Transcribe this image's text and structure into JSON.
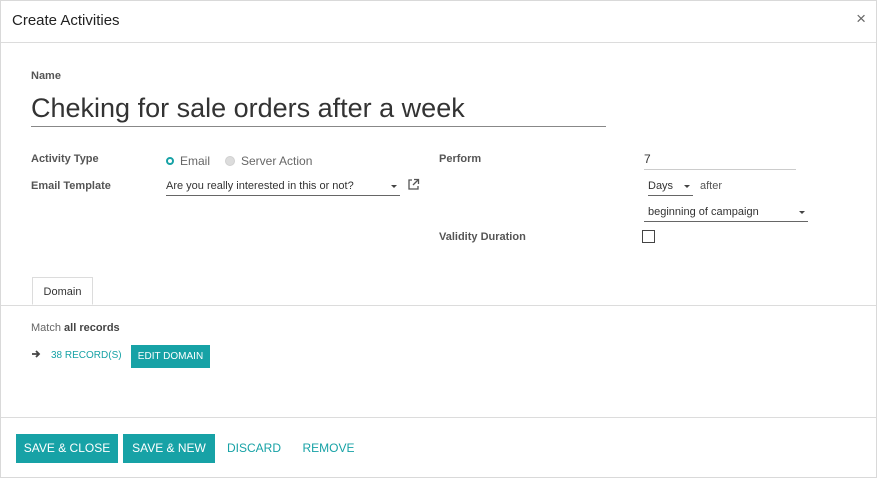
{
  "dialog": {
    "title": "Create Activities",
    "close_glyph": "×",
    "close_icon": "close-icon"
  },
  "form": {
    "name_label": "Name",
    "name_value": "Cheking for sale orders after a week",
    "activity_type_label": "Activity Type",
    "activity_type_options": [
      {
        "label": "Email",
        "selected": true
      },
      {
        "label": "Server Action",
        "selected": false
      }
    ],
    "email_template_label": "Email Template",
    "email_template_value": "Are you really interested in this or not?",
    "email_template_link_icon": "external-link-icon",
    "perform_label": "Perform",
    "perform_value": "7",
    "perform_unit": "Days",
    "after_text": "after",
    "perform_reference": "beginning of campaign",
    "validity_label": "Validity Duration",
    "validity_checked": false
  },
  "tabs": {
    "domain_label": "Domain"
  },
  "domain": {
    "match_prefix": "Match",
    "match_scope": "all records",
    "arrow_icon": "arrow-right-icon",
    "records_label": "38 RECORD(S)",
    "edit_label": "EDIT DOMAIN"
  },
  "footer": {
    "save_close": "SAVE & CLOSE",
    "save_new": "SAVE & NEW",
    "discard": "DISCARD",
    "remove": "REMOVE"
  },
  "colors": {
    "accent": "#17a2a6"
  }
}
